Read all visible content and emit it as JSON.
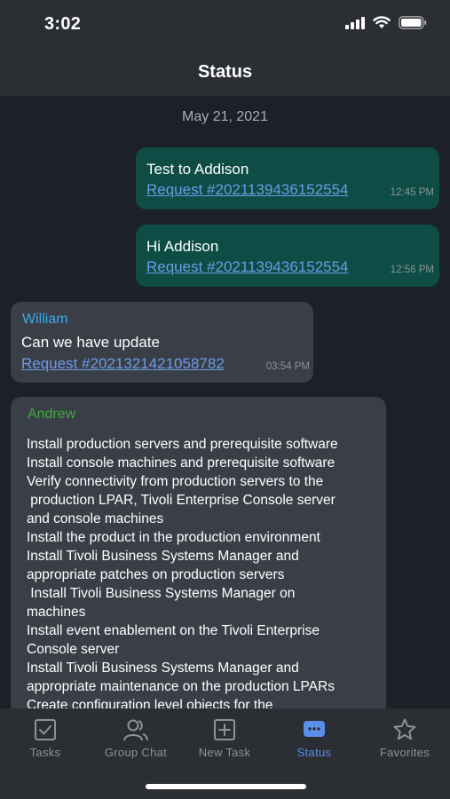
{
  "status_bar": {
    "time": "3:02"
  },
  "nav": {
    "title": "Status"
  },
  "chat": {
    "date": "May 21, 2021",
    "messages": [
      {
        "text": "Test to Addison",
        "link": "Request #2021139436152554",
        "time": "12:45 PM"
      },
      {
        "text": "Hi Addison",
        "link": "Request #2021139436152554",
        "time": "12:56 PM"
      },
      {
        "sender": "William",
        "text": "Can we have update",
        "link": "Request #2021321421058782",
        "time": "03:54 PM"
      },
      {
        "sender": "Andrew",
        "lines": [
          "Install production servers and prerequisite software",
          "Install console machines and prerequisite software",
          "Verify connectivity from production servers to the",
          " production LPAR, Tivoli Enterprise Console server",
          "and console machines",
          "Install the product in the production environment",
          "Install Tivoli Business Systems Manager and",
          "appropriate patches on production servers",
          " Install Tivoli Business Systems Manager on",
          "machines",
          "Install event enablement on the Tivoli Enterprise",
          "Console server",
          "Install Tivoli Business Systems Manager and",
          "appropriate maintenance on the production LPARs",
          "Create configuration level objects for the"
        ]
      }
    ]
  },
  "colors": {
    "accent": "#5b8ee8",
    "outgoing": "#0d4d45",
    "incoming": "#3a3f47",
    "william": "#3aa9e8",
    "andrew": "#3fa63f"
  },
  "tabs": [
    {
      "label": "Tasks",
      "icon": "checkbox-icon"
    },
    {
      "label": "Group Chat",
      "icon": "people-icon"
    },
    {
      "label": "New Task",
      "icon": "plus-square-icon"
    },
    {
      "label": "Status",
      "icon": "chat-bubble-icon",
      "active": true
    },
    {
      "label": "Favorites",
      "icon": "star-icon"
    }
  ]
}
